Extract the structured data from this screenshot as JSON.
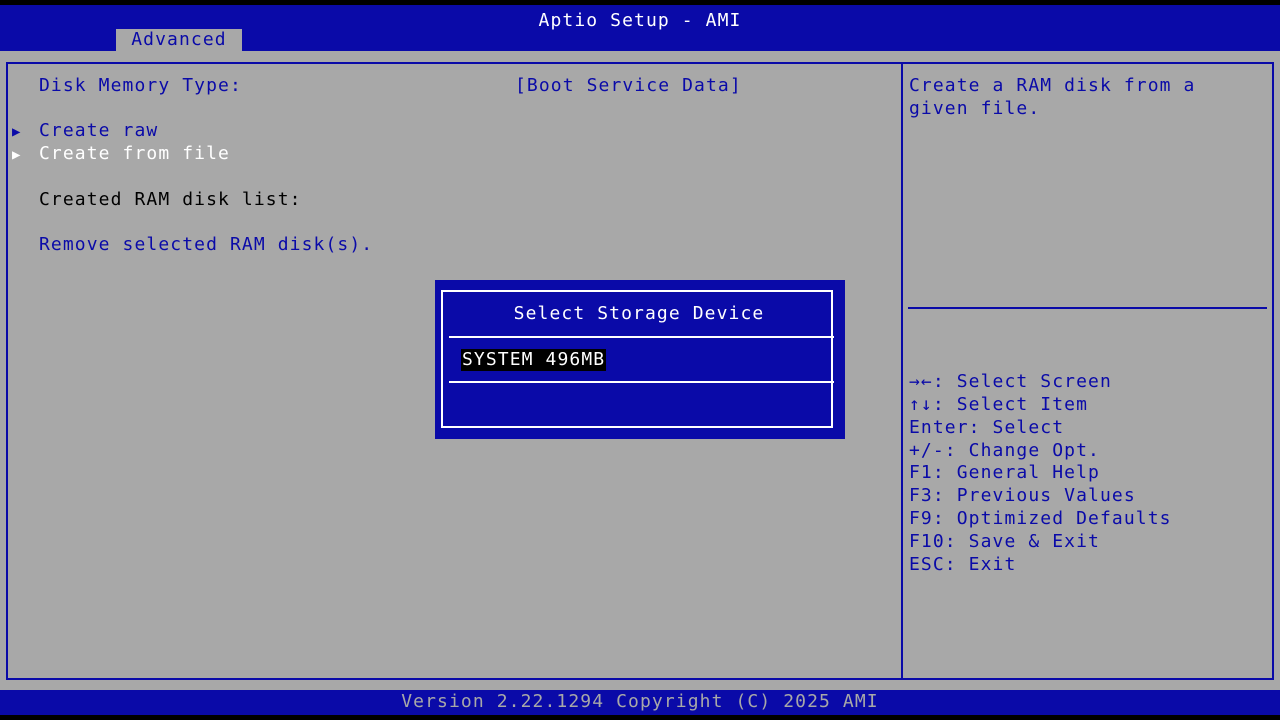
{
  "header": {
    "title": "Aptio Setup - AMI",
    "tab": "Advanced"
  },
  "left_panel": {
    "disk_memory_type_label": "Disk Memory Type:",
    "disk_memory_type_value": "[Boot Service Data]",
    "create_raw": "Create raw",
    "create_from_file": "Create from file",
    "created_list_label": "Created RAM disk list:",
    "remove_selected": "Remove selected RAM disk(s).",
    "submenu_arrow": "▶"
  },
  "help": {
    "line1": "Create a RAM disk from a",
    "line2": "given file."
  },
  "keys": [
    "→←: Select Screen",
    "↑↓: Select Item",
    "Enter: Select",
    "+/-: Change Opt.",
    "F1: General Help",
    "F3: Previous Values",
    "F9: Optimized Defaults",
    "F10: Save & Exit",
    "ESC: Exit"
  ],
  "popup": {
    "title": "Select Storage Device",
    "item": "SYSTEM 496MB"
  },
  "footer": {
    "version": "Version 2.22.1294 Copyright (C) 2025 AMI"
  },
  "colors": {
    "bios_blue": "#0a0aa8",
    "bios_gray": "#a8a8a8",
    "highlight": "#ffffff"
  }
}
